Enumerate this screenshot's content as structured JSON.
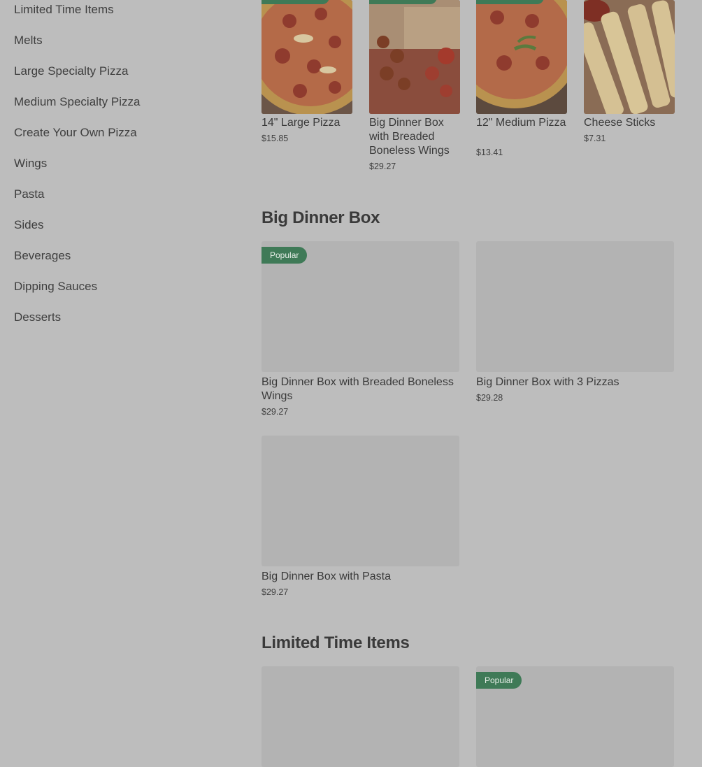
{
  "sidebar": {
    "items": [
      {
        "label": "Limited Time Items"
      },
      {
        "label": "Melts"
      },
      {
        "label": "Large Specialty Pizza"
      },
      {
        "label": "Medium Specialty Pizza"
      },
      {
        "label": "Create Your Own Pizza"
      },
      {
        "label": "Wings"
      },
      {
        "label": "Pasta"
      },
      {
        "label": "Sides"
      },
      {
        "label": "Beverages"
      },
      {
        "label": "Dipping Sauces"
      },
      {
        "label": "Desserts"
      }
    ]
  },
  "featured": {
    "items": [
      {
        "name": "14\" Large Pizza",
        "price": "$15.85"
      },
      {
        "name": "Big Dinner Box with Breaded Boneless Wings",
        "price": "$29.27"
      },
      {
        "name": "12\" Medium Pizza",
        "price": "$13.41"
      },
      {
        "name": "Cheese Sticks",
        "price": "$7.31"
      }
    ]
  },
  "big_dinner_box": {
    "title": "Big Dinner Box",
    "items": [
      {
        "name": "Big Dinner Box with Breaded Boneless Wings",
        "price": "$29.27",
        "badge": "Popular"
      },
      {
        "name": "Big Dinner Box with 3 Pizzas",
        "price": "$29.28"
      },
      {
        "name": "Big Dinner Box with Pasta",
        "price": "$29.27"
      }
    ]
  },
  "limited_time": {
    "title": "Limited Time Items",
    "items": [
      {
        "badge": ""
      },
      {
        "badge": "Popular"
      }
    ]
  },
  "colors": {
    "page_bg": "#bdbdbd",
    "badge_bg": "#3f7a57",
    "placeholder": "#b3b3b3"
  }
}
